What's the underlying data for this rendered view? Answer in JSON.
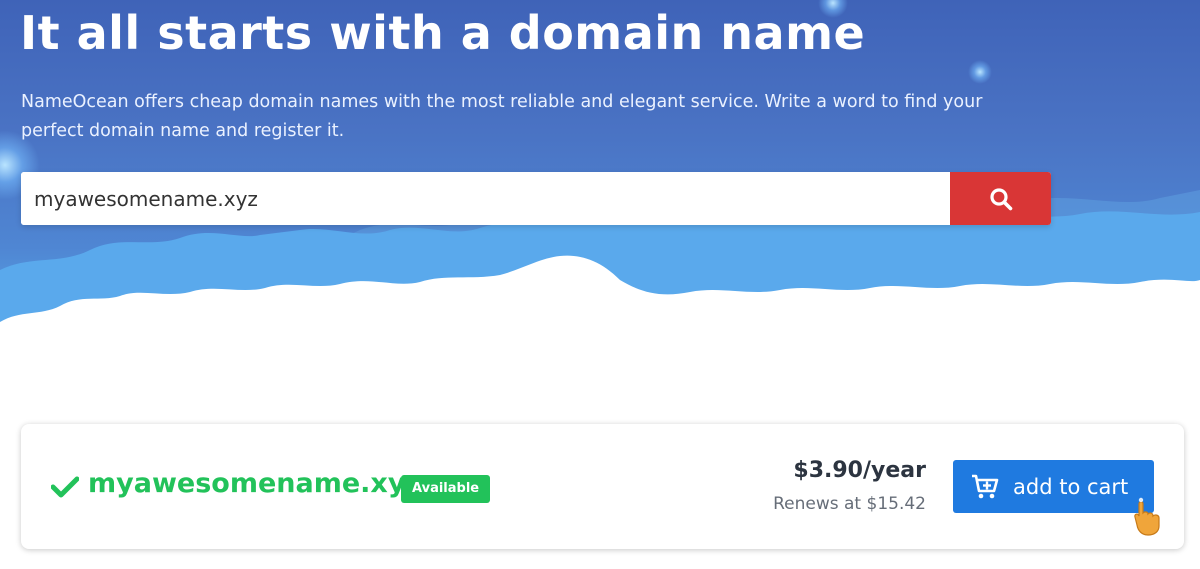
{
  "hero": {
    "title": "It all starts with a domain name",
    "subtitle": "NameOcean offers cheap domain names with the most reliable and elegant service. Write a word to find your perfect domain name and register it."
  },
  "search": {
    "value": "myawesomename.xyz",
    "button_icon": "search-icon"
  },
  "result": {
    "status_icon": "check-icon",
    "domain": "myawesomename.xyz",
    "badge": "Available",
    "price": "$3.90/year",
    "renews": "Renews at $15.42",
    "cart_label": "add to cart",
    "cart_icon": "cart-plus-icon",
    "cursor_icon": "pointing-hand-icon"
  },
  "colors": {
    "hero_top": "#3f63b8",
    "hero_bottom": "#5aa7e6",
    "search_button": "#d93636",
    "available_green": "#22c25a",
    "cart_blue": "#1f7ae0"
  }
}
